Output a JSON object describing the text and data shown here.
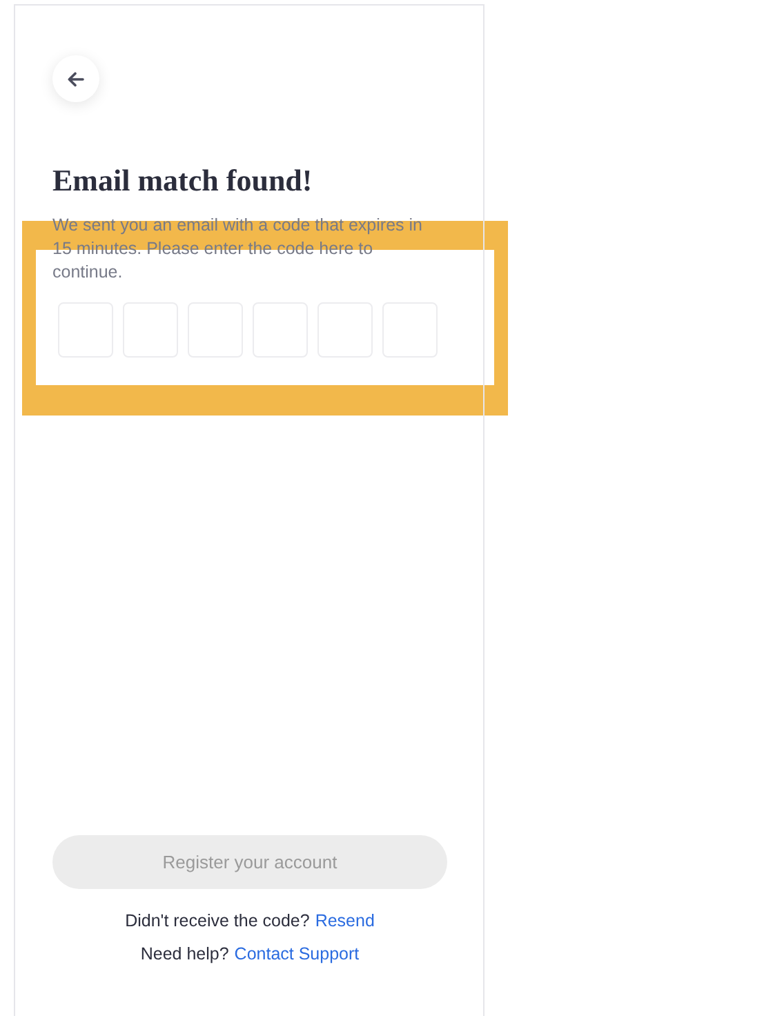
{
  "back_button": {
    "kind": "back"
  },
  "title": "Email match found!",
  "description": "We sent you an email with a code that expires in 15 minutes. Please enter the code here to continue.",
  "code_fields": [
    {
      "kind": "digit"
    },
    {
      "kind": "digit"
    },
    {
      "kind": "digit"
    },
    {
      "kind": "digit"
    },
    {
      "kind": "digit"
    },
    {
      "kind": "digit"
    }
  ],
  "submit_button": {
    "label": "Register your account",
    "disabled": true
  },
  "help_lines": [
    {
      "text": "Didn't receive the code?",
      "link": "Resend"
    },
    {
      "text": "Need help?",
      "link": "Contact Support"
    }
  ]
}
